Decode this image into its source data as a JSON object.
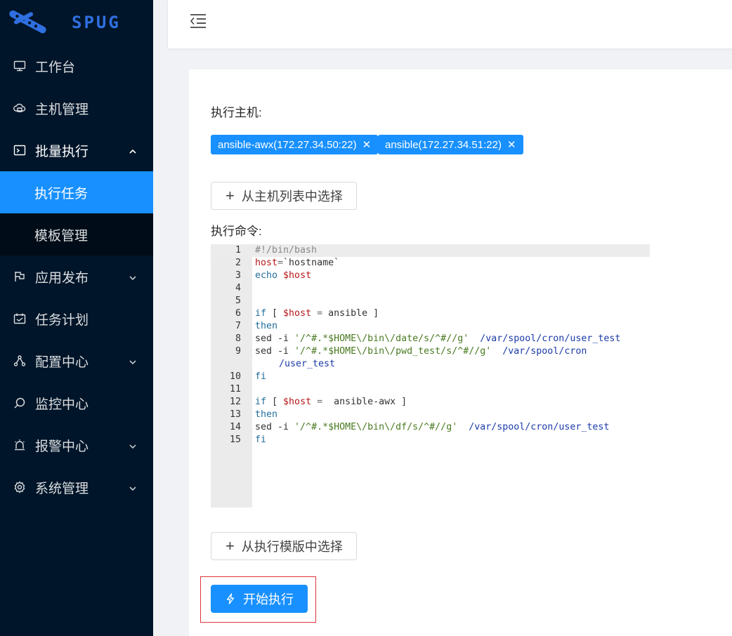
{
  "app": {
    "logo_text": "SPUG"
  },
  "sidebar": {
    "items": [
      {
        "label": "工作台",
        "icon": "monitor-icon"
      },
      {
        "label": "主机管理",
        "icon": "cloud-server-icon"
      },
      {
        "label": "批量执行",
        "icon": "terminal-icon",
        "expanded": true,
        "children": [
          {
            "label": "执行任务",
            "active": true
          },
          {
            "label": "模板管理"
          }
        ]
      },
      {
        "label": "应用发布",
        "icon": "flag-icon",
        "has_children": true
      },
      {
        "label": "任务计划",
        "icon": "schedule-icon"
      },
      {
        "label": "配置中心",
        "icon": "deployment-icon",
        "has_children": true
      },
      {
        "label": "监控中心",
        "icon": "search-icon"
      },
      {
        "label": "报警中心",
        "icon": "alert-icon",
        "has_children": true
      },
      {
        "label": "系统管理",
        "icon": "setting-icon",
        "has_children": true
      }
    ]
  },
  "form": {
    "hosts_label": "执行主机:",
    "hosts": [
      {
        "label": "ansible-awx(172.27.34.50:22)"
      },
      {
        "label": "ansible(172.27.34.51:22)"
      }
    ],
    "select_hosts_button": "从主机列表中选择",
    "command_label": "执行命令:",
    "select_template_button": "从执行模版中选择",
    "start_button": "开始执行"
  },
  "editor": {
    "lines": [
      {
        "num": "1",
        "text": "#!/bin/bash"
      },
      {
        "num": "2",
        "text": "host=`hostname`"
      },
      {
        "num": "3",
        "text": "echo $host"
      },
      {
        "num": "4",
        "text": ""
      },
      {
        "num": "5",
        "text": ""
      },
      {
        "num": "6",
        "text": "if [ $host = ansible ]"
      },
      {
        "num": "7",
        "text": "then"
      },
      {
        "num": "8",
        "text": "sed -i '/^#.*$HOME\\/bin\\/date/s/^#//g'  /var/spool/cron/user_test"
      },
      {
        "num": "9",
        "text": "sed -i '/^#.*$HOME\\/bin\\/pwd_test/s/^#//g'  /var/spool/cron"
      },
      {
        "num": "",
        "text": "/user_test"
      },
      {
        "num": "10",
        "text": "fi"
      },
      {
        "num": "11",
        "text": ""
      },
      {
        "num": "12",
        "text": "if [ $host =  ansible-awx ]"
      },
      {
        "num": "13",
        "text": "then"
      },
      {
        "num": "14",
        "text": "sed -i '/^#.*$HOME\\/bin\\/df/s/^#//g'  /var/spool/cron/user_test"
      },
      {
        "num": "15",
        "text": "fi"
      }
    ]
  },
  "colors": {
    "sidebar_bg": "#001529",
    "submenu_bg": "#000c17",
    "primary": "#1890ff",
    "highlight_border": "#e0343a"
  }
}
